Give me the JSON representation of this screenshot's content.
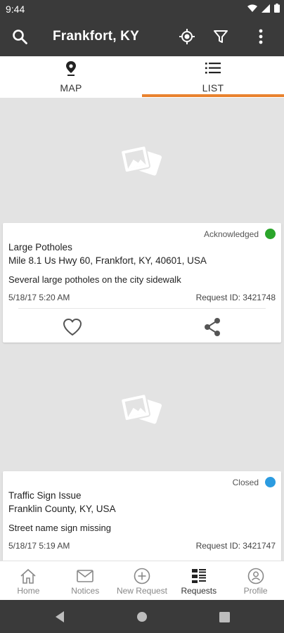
{
  "status_bar": {
    "time": "9:44"
  },
  "app_bar": {
    "title": "Frankfort, KY",
    "icons": [
      "search-icon",
      "my-location-icon",
      "filter-icon",
      "more-vert-icon"
    ]
  },
  "tabs": [
    {
      "label": "MAP",
      "icon": "map-pin-icon",
      "active": false
    },
    {
      "label": "LIST",
      "icon": "list-icon",
      "active": true
    }
  ],
  "colors": {
    "accent": "#e9822e",
    "acknowledged": "#2aa52a",
    "closed": "#2b9be0",
    "bar": "#3a3a3a"
  },
  "requests": [
    {
      "status": "Acknowledged",
      "title": "Large Potholes",
      "address": "Mile 8.1 Us Hwy 60, Frankfort, KY, 40601, USA",
      "description": "Several large potholes on the city sidewalk",
      "date": "5/18/17 5:20 AM",
      "request_id": "Request ID: 3421748"
    },
    {
      "status": "Closed",
      "title": "Traffic Sign Issue",
      "address": "Franklin County, KY, USA",
      "description": "Street name sign missing",
      "date": "5/18/17 5:19 AM",
      "request_id": "Request ID: 3421747"
    }
  ],
  "bottom_nav": [
    {
      "label": "Home",
      "icon": "home-icon"
    },
    {
      "label": "Notices",
      "icon": "mail-icon"
    },
    {
      "label": "New Request",
      "icon": "add-circle-icon"
    },
    {
      "label": "Requests",
      "icon": "requests-list-icon",
      "active": true
    },
    {
      "label": "Profile",
      "icon": "profile-icon"
    }
  ]
}
